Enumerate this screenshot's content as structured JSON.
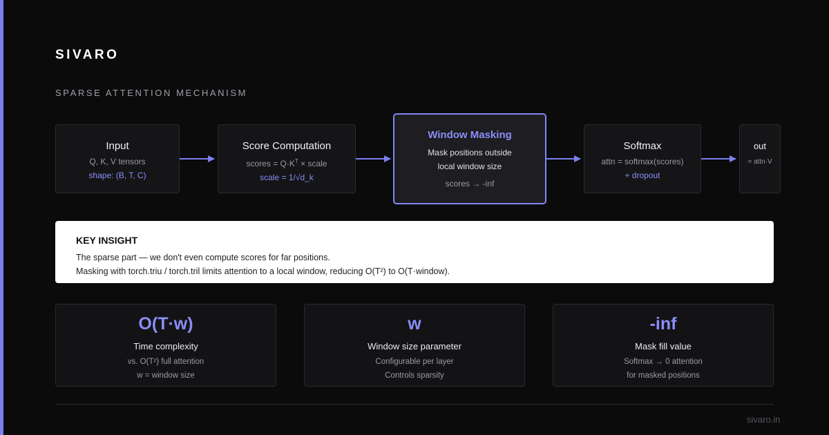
{
  "brand": "SIVARO",
  "subtitle": "SPARSE ATTENTION MECHANISM",
  "pipeline": {
    "input": {
      "title": "Input",
      "line1": "Q, K, V tensors",
      "line2": "shape: (B, T, C)"
    },
    "score": {
      "title": "Score Computation",
      "line1_pre": "scores = Q·K",
      "line1_sup": "T",
      "line1_post": " × scale",
      "line2": "scale = 1/√d_k"
    },
    "mask": {
      "title": "Window Masking",
      "desc1": "Mask positions outside",
      "desc2": "local window size",
      "line": "scores → -inf"
    },
    "softmax": {
      "title": "Softmax",
      "line1": "attn = softmax(scores)",
      "line2": "+ dropout"
    },
    "out": {
      "title": "out",
      "line1": "= attn·V"
    }
  },
  "insight": {
    "heading": "KEY INSIGHT",
    "line1": "The sparse part — we don't even compute scores for far positions.",
    "line2": "Masking with torch.triu / torch.tril limits attention to a local window, reducing O(T²) to O(T·window)."
  },
  "stats": [
    {
      "value": "O(T·w)",
      "label": "Time complexity",
      "sub1": "vs. O(T²) full attention",
      "sub2": "w = window size"
    },
    {
      "value": "w",
      "label": "Window size parameter",
      "sub1": "Configurable per layer",
      "sub2": "Controls sparsity"
    },
    {
      "value": "-inf",
      "label": "Mask fill value",
      "sub1": "Softmax → 0 attention",
      "sub2": "for masked positions"
    }
  ],
  "footer": "sivaro.in",
  "colors": {
    "accent": "#7c80f0",
    "highlight": "#8a8ef5",
    "background": "#0b0b0c",
    "card": "#151518",
    "insight_bg": "#ffffff"
  }
}
